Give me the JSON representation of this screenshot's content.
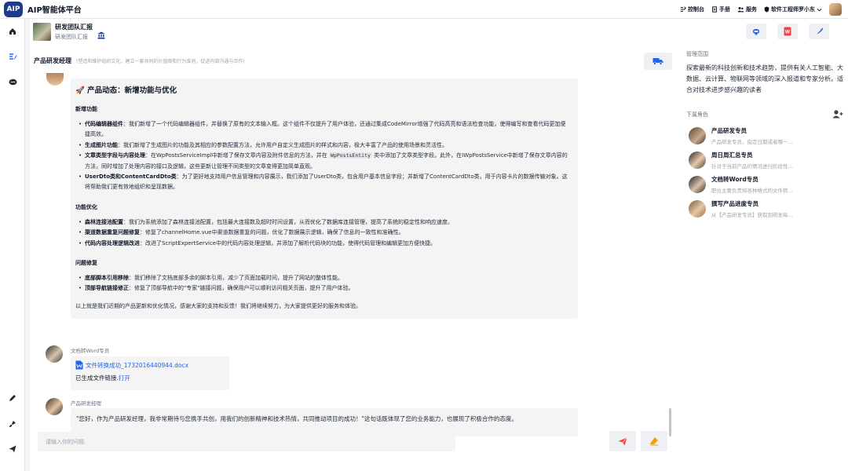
{
  "app": {
    "logo": "AIP",
    "title": "AIP智能体平台"
  },
  "topbar": {
    "items": [
      {
        "label": "控制台",
        "icon": "console-icon"
      },
      {
        "label": "手册",
        "icon": "manual-icon"
      },
      {
        "label": "服务",
        "icon": "service-icon"
      }
    ],
    "user": {
      "label": "软件工程师罗小东",
      "icon": "shield-icon"
    }
  },
  "team": {
    "title": "研发团队汇报",
    "subtitle": "研发团队汇报"
  },
  "chat": {
    "role_title": "产品研发经理",
    "role_desc": "(塑造和维护组织文化，建立一套共同的价值观和行为准则，促进内部沟通与合作)",
    "update": {
      "title": "🚀 产品动态：新增功能与优化",
      "sections": [
        {
          "heading": "新增功能",
          "items": [
            {
              "bold": "代码编辑器组件",
              "text": "：我们新增了一个代码编辑器组件，并替换了原有的文本输入框。这个组件不仅提升了用户体验，还通过集成CodeMirror增强了代码高亮和语法检查功能，使得编写和查看代码更加便捷高效。"
            },
            {
              "bold": "生成图片功能",
              "text": "：我们新增了生成图片的功能及其相应的参数配置方法，允许用户自定义生成图片的样式和内容，极大丰富了产品的使用场景和灵活性。"
            },
            {
              "bold": "文章类型字段与内容处理",
              "text_a": "：在WpPostsServiceImpl中新增了保存文章内容及附件信息的方法，并在 ",
              "code": "WpPostsEntity",
              "text_b": " 类中添加了文章类型字段。此外，在IWpPostsService中新增了保存文章内容的方法，同时增加了处理内容的接口及逻辑，这些更新让管理不同类型的文章变得更加简单直观。"
            },
            {
              "bold": "UserDto类和ContentCardDto类",
              "text": "：为了更好地支持用户信息管理和内容展示，我们添加了UserDto类，包含用户基本信息字段；并新增了ContentCardDto类，用于内容卡片的数据传输对象。这将帮助我们更有效地组织和呈现数据。"
            }
          ]
        },
        {
          "heading": "功能优化",
          "items": [
            {
              "bold": "森林连接池配置",
              "text": "：我们为系统添加了森林连接池配置，包括最大连接数及超时时间设置，从而优化了数据库连接管理，提高了系统的稳定性和响应速度。"
            },
            {
              "bold": "渠道数据重复问题修复",
              "text": "：修复了channelHome.vue中渠道数据重复的问题，优化了数据展示逻辑，确保了信息的一致性和准确性。"
            },
            {
              "bold": "代码内容处理逻辑改进",
              "text": "：改进了ScriptExpertService中的代码内容处理逻辑，并添加了解析代码块的功能，使得代码管理和编辑更加方便快捷。"
            }
          ]
        },
        {
          "heading": "问题修复",
          "items": [
            {
              "bold": "底部脚本引用移除",
              "text": "：我们移除了文档底部多余的脚本引用，减少了页面加载时间，提升了网站的整体性能。"
            },
            {
              "bold": "顶部导航链接修正",
              "text": "：修复了顶部导航中的\"专家\"链接问题，确保用户可以顺利访问相关页面，提升了用户体验。"
            }
          ]
        }
      ],
      "closing": "以上就是我们近期的产品更新和优化情况，感谢大家的支持和反馈！我们将继续努力，为大家提供更好的服务和体验。"
    },
    "file_msg": {
      "sender": "文档转Word专员",
      "file_name": "文件转换成功_1732016440944.docx",
      "status_text": "已生成文件链接.",
      "open_label": "打开"
    },
    "reply_msg": {
      "sender": "产品研发经理",
      "text": "\"您好，作为产品研发经理，我非常期待与您携手共创，用我们的创新精神和技术热情，共同推动项目的成功！\"这句话既体现了您的业务能力，也展现了积极合作的态度。"
    },
    "input": {
      "placeholder": "请输入你的问题.",
      "value": ""
    }
  },
  "right": {
    "scope_label": "管理范围",
    "scope_text": "探索最新的科技创新和技术趋势，提供有关人工智能、大数据、云计算、物联网等领域的深入报道和专家分析。适合对技术进步感兴趣的读者",
    "sub_label": "下属角色",
    "sub_roles": [
      {
        "name": "产品研发专员",
        "desc": "产品研发专员，指定日期或者哪一..."
      },
      {
        "name": "周日周汇总专员",
        "desc": "针对于当前产品的情况进行阶段性..."
      },
      {
        "name": "文档转Word专员",
        "desc": "职位主要负责将各种格式的文件转..."
      },
      {
        "name": "撰写产品进度专员",
        "desc": "从【产品研发专员】获取到研发每..."
      }
    ]
  },
  "colors": {
    "brand": "#1e3a8a",
    "link": "#2563eb",
    "send": "#ef4444",
    "brush": "#f59e0b",
    "accent_blue": "#2563eb"
  }
}
